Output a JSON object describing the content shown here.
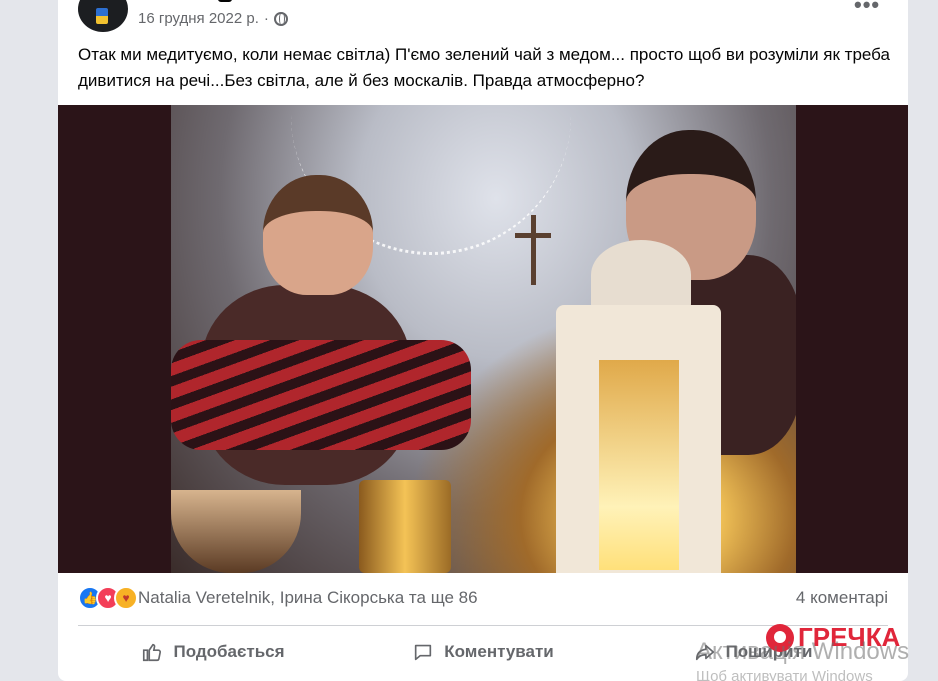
{
  "post": {
    "date": "16 грудня 2022 р.",
    "separator": "·",
    "more_label": "•••",
    "text": "Отак ми медитуємо, коли немає світла) П'ємо зелений чай з медом... просто щоб ви розуміли як треба дивитися на речі...Без світла, але й без москалів. Правда атмосферно?"
  },
  "reactions": {
    "names": "Natalia Veretelnik, Ірина Сікорська та ще 86",
    "comments": "4 коментарі",
    "icons": [
      "like-reaction-icon",
      "love-reaction-icon",
      "care-reaction-icon"
    ]
  },
  "actions": {
    "like": "Подобається",
    "comment": "Коментувати",
    "share": "Поширити"
  },
  "overlay": {
    "logo_text": "ГРЕЧКА",
    "activate_line": "Активація Windows",
    "activate_sub": "Щоб активувати Windows"
  },
  "colors": {
    "accent": "#1877f2",
    "logo": "#e0263a",
    "secondary_text": "#65676b"
  }
}
